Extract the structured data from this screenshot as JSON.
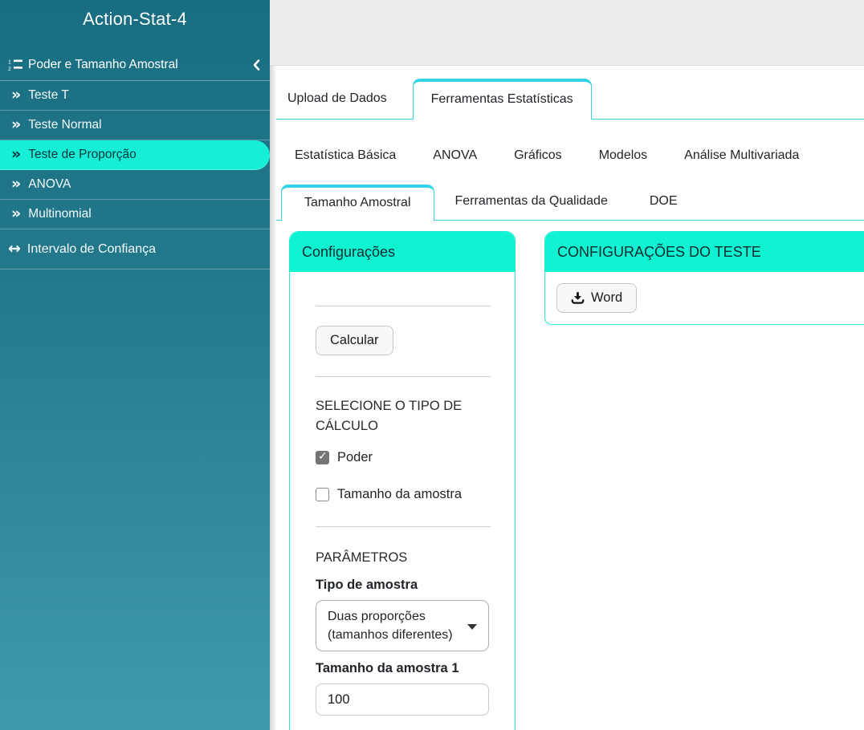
{
  "colors": {
    "sidebar_gradient_top": "#186d81",
    "sidebar_gradient_bottom": "#3f9aad",
    "sidebar_active_item_bg": "#16efd5",
    "panel_header_bg": "#0ff3d3",
    "tab_accent": "#31d4e8",
    "card_border": "#23ecd2",
    "topbar_bg": "#ededed"
  },
  "icons": {
    "double_chevron_right": "»",
    "left_right_arrow": "↔"
  },
  "sidebar": {
    "app_title": "Action-Stat-4",
    "section": {
      "label": "Poder e Tamanho Amostral"
    },
    "items": [
      {
        "label": "Teste T",
        "active": false
      },
      {
        "label": "Teste Normal",
        "active": false
      },
      {
        "label": "Teste de Proporção",
        "active": true
      },
      {
        "label": "ANOVA",
        "active": false
      },
      {
        "label": "Multinomial",
        "active": false
      }
    ],
    "footer_item": {
      "label": "Intervalo de Confiança"
    }
  },
  "tabs": {
    "primary": [
      {
        "label": "Upload de Dados",
        "active": false
      },
      {
        "label": "Ferramentas Estatísticas",
        "active": true
      }
    ],
    "secondary": [
      {
        "label": "Estatística Básica"
      },
      {
        "label": "ANOVA"
      },
      {
        "label": "Gráficos"
      },
      {
        "label": "Modelos"
      },
      {
        "label": "Análise Multivariada"
      }
    ],
    "tertiary": [
      {
        "label": "Tamanho Amostral",
        "active": true
      },
      {
        "label": "Ferramentas da Qualidade",
        "active": false
      },
      {
        "label": "DOE",
        "active": false
      }
    ]
  },
  "config_panel": {
    "title": "Configurações",
    "calculate_button": "Calcular",
    "calc_type_label": "SELECIONE O TIPO DE CÁLCULO",
    "calc_type_options": [
      {
        "label": "Poder",
        "checked": true
      },
      {
        "label": "Tamanho da amostra",
        "checked": false
      }
    ],
    "parameters_label": "PARÂMETROS",
    "sample_type_label": "Tipo de amostra",
    "sample_type_value": "Duas proporções (tamanhos diferentes)",
    "sample_size_label": "Tamanho da amostra 1",
    "sample_size_value": "100"
  },
  "test_panel": {
    "title": "CONFIGURAÇÕES DO TESTE",
    "word_button": "Word"
  }
}
